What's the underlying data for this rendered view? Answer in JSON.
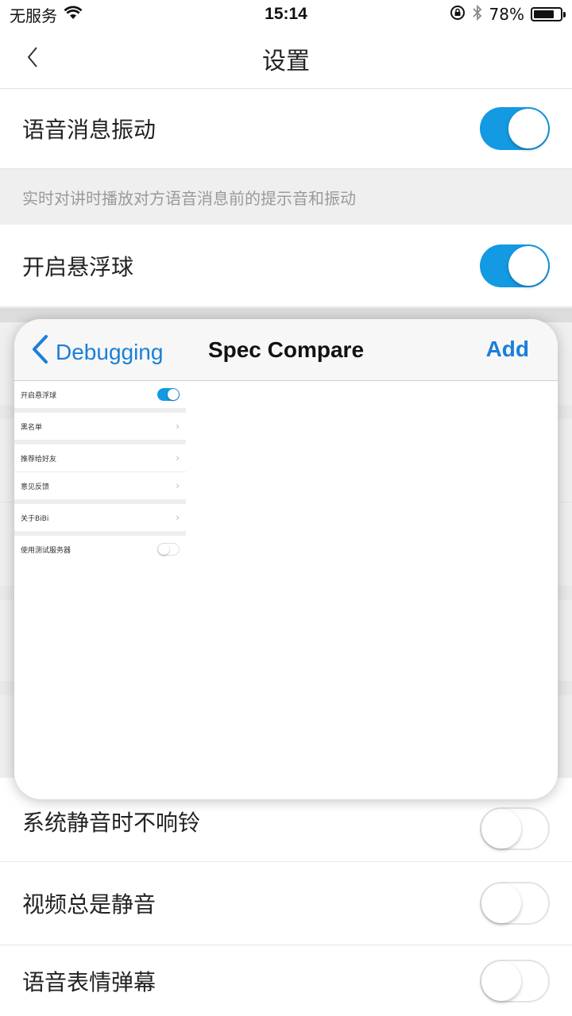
{
  "status_bar": {
    "carrier": "无服务",
    "time": "15:14",
    "battery_percent": "78%",
    "battery_level": 0.78,
    "icons": [
      "wifi-icon",
      "rotation-lock-icon",
      "bluetooth-icon",
      "battery-icon"
    ]
  },
  "nav": {
    "title": "设置",
    "back_icon": "chevron-left-icon"
  },
  "settings": {
    "voice_vibrate": {
      "label": "语音消息振动",
      "state": "on"
    },
    "voice_vibrate_hint": "实时对讲时播放对方语音消息前的提示音和振动",
    "floating_ball": {
      "label": "开启悬浮球",
      "state": "on"
    },
    "mute_no_ring": {
      "label": "系统静音时不响铃",
      "state": "off"
    },
    "video_mute": {
      "label": "视频总是静音",
      "state": "off"
    },
    "voice_emoji_barrage": {
      "label": "语音表情弹幕",
      "state": "off"
    }
  },
  "overlay": {
    "back_label": "Debugging",
    "title": "Spec Compare",
    "add_label": "Add",
    "mini_items": [
      {
        "label": "开启悬浮球",
        "type": "toggle",
        "state": "on"
      },
      {
        "label": "黑名单",
        "type": "chevron"
      },
      {
        "label": "推荐给好友",
        "type": "chevron"
      },
      {
        "label": "意见反馈",
        "type": "chevron"
      },
      {
        "label": "关于BiBi",
        "type": "chevron"
      },
      {
        "label": "使用测试服务器",
        "type": "toggle",
        "state": "off"
      }
    ]
  },
  "colors": {
    "accent": "#1499e3",
    "link": "#1a7fd9",
    "background": "#efeff0",
    "hint_text": "#9a9a9a"
  }
}
